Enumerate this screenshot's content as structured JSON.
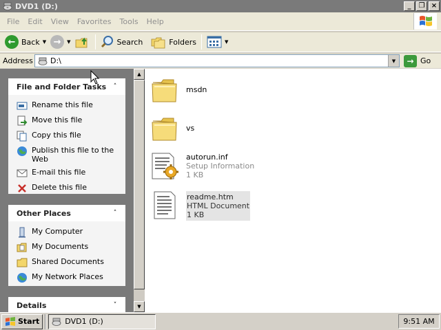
{
  "window": {
    "title": "DVD1 (D:)",
    "controls": [
      "_",
      "❐",
      "×"
    ]
  },
  "menu": [
    "File",
    "Edit",
    "View",
    "Favorites",
    "Tools",
    "Help"
  ],
  "toolbar": {
    "back": "Back",
    "search": "Search",
    "folders": "Folders"
  },
  "address": {
    "label": "Address",
    "value": "D:\\",
    "go": "Go"
  },
  "tasks_panel": {
    "title": "File and Folder Tasks",
    "items": [
      {
        "label": "Rename this file",
        "icon": "rename-icon"
      },
      {
        "label": "Move this file",
        "icon": "move-icon"
      },
      {
        "label": "Copy this file",
        "icon": "copy-icon"
      },
      {
        "label": "Publish this file to the Web",
        "icon": "publish-web-icon"
      },
      {
        "label": "E-mail this file",
        "icon": "email-icon"
      },
      {
        "label": "Delete this file",
        "icon": "delete-icon"
      }
    ]
  },
  "places_panel": {
    "title": "Other Places",
    "items": [
      {
        "label": "My Computer",
        "icon": "my-computer-icon"
      },
      {
        "label": "My Documents",
        "icon": "my-documents-icon"
      },
      {
        "label": "Shared Documents",
        "icon": "shared-folder-icon"
      },
      {
        "label": "My Network Places",
        "icon": "network-places-icon"
      }
    ]
  },
  "details_panel": {
    "title": "Details"
  },
  "files": [
    {
      "name": "msdn",
      "type": "",
      "size": "",
      "icon": "folder-icon",
      "selected": false
    },
    {
      "name": "vs",
      "type": "",
      "size": "",
      "icon": "folder-icon",
      "selected": false
    },
    {
      "name": "autorun.inf",
      "type": "Setup Information",
      "size": "1 KB",
      "icon": "setup-info-icon",
      "selected": false
    },
    {
      "name": "readme.htm",
      "type": "HTML Document",
      "size": "1 KB",
      "icon": "html-document-icon",
      "selected": true
    }
  ],
  "taskbar": {
    "start": "Start",
    "task": "DVD1 (D:)",
    "clock": "9:51 AM"
  },
  "colors": {
    "title_bar": "#7a7a7a",
    "side_pane": "#7a7a7a",
    "go_green": "#3c9a3c",
    "folder_yellow": "#f3d66a"
  }
}
